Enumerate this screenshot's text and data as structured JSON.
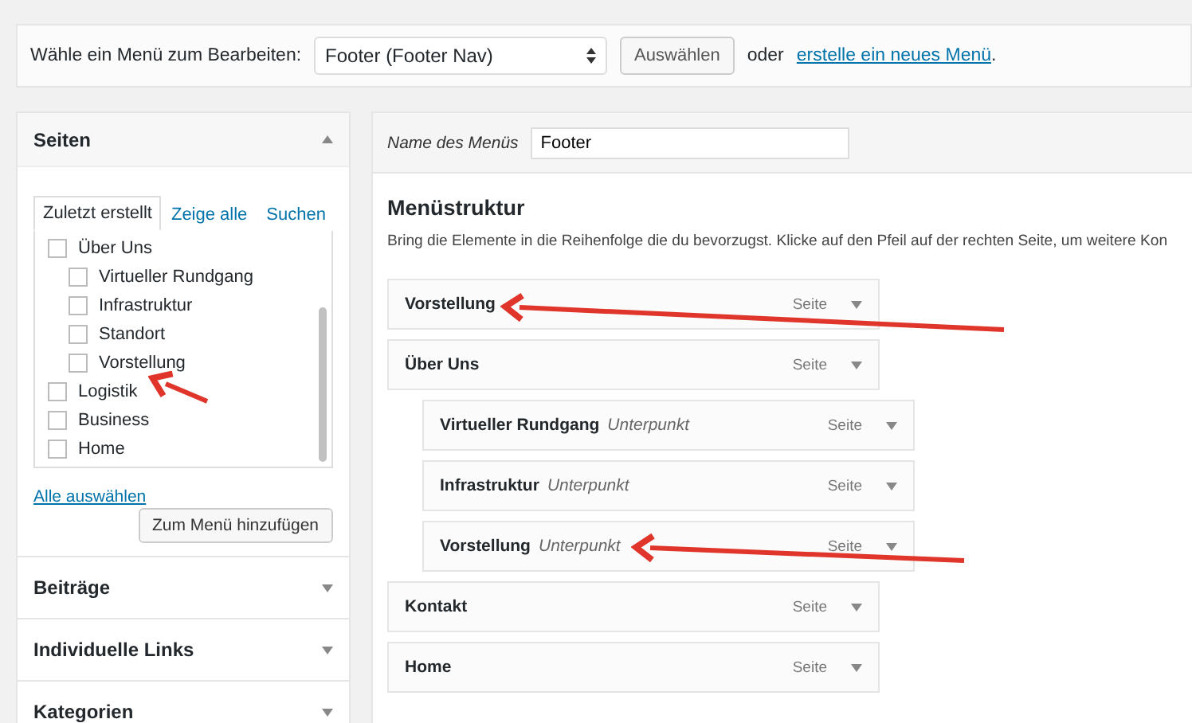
{
  "menu_select": {
    "label": "Wähle ein Menü zum Bearbeiten:",
    "value": "Footer (Footer Nav)",
    "button": "Auswählen",
    "or_text": "oder",
    "create_link": "erstelle ein neues Menü",
    "after_link": "."
  },
  "sidebar": {
    "sections": [
      {
        "title": "Seiten",
        "expanded": true,
        "tabs": [
          {
            "label": "Zuletzt erstellt",
            "selected": true
          },
          {
            "label": "Zeige alle",
            "selected": false
          },
          {
            "label": "Suchen",
            "selected": false
          }
        ],
        "pages": [
          {
            "label": "Über Uns",
            "checked": false,
            "children": [
              {
                "label": "Virtueller Rundgang",
                "checked": false
              },
              {
                "label": "Infrastruktur",
                "checked": false
              },
              {
                "label": "Standort",
                "checked": false
              },
              {
                "label": "Vorstellung",
                "checked": false
              }
            ]
          },
          {
            "label": "Logistik",
            "checked": false
          },
          {
            "label": "Business",
            "checked": false
          },
          {
            "label": "Home",
            "checked": false
          }
        ],
        "select_all": "Alle auswählen",
        "add_button": "Zum Menü hinzufügen"
      },
      {
        "title": "Beiträge",
        "expanded": false
      },
      {
        "title": "Individuelle Links",
        "expanded": false
      },
      {
        "title": "Kategorien",
        "expanded": false
      }
    ]
  },
  "editor": {
    "name_label": "Name des Menüs",
    "name_value": "Footer",
    "heading": "Menüstruktur",
    "description": "Bring die Elemente in die Reihenfolge die du bevorzugst. Klicke auf den Pfeil auf der rechten Seite, um weitere Kon",
    "items": [
      {
        "title": "Vorstellung",
        "type": "Seite"
      },
      {
        "title": "Über Uns",
        "type": "Seite",
        "children": [
          {
            "title": "Virtueller Rundgang",
            "sub": "Unterpunkt",
            "type": "Seite"
          },
          {
            "title": "Infrastruktur",
            "sub": "Unterpunkt",
            "type": "Seite"
          },
          {
            "title": "Vorstellung",
            "sub": "Unterpunkt",
            "type": "Seite"
          }
        ]
      },
      {
        "title": "Kontakt",
        "type": "Seite"
      },
      {
        "title": "Home",
        "type": "Seite"
      }
    ]
  }
}
